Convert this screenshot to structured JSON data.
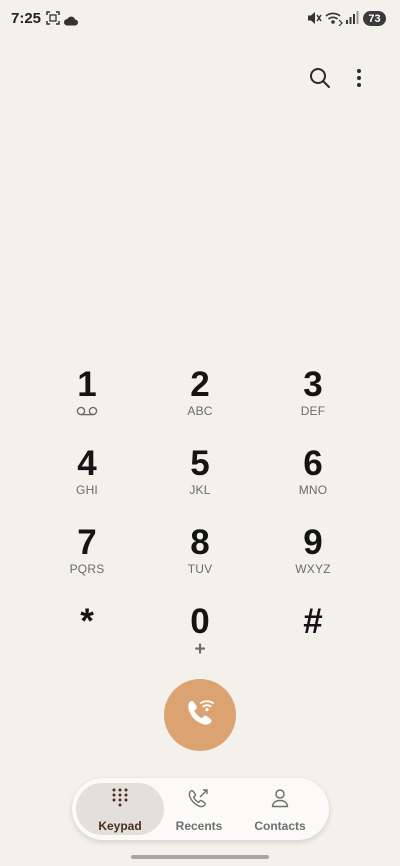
{
  "status_bar": {
    "time": "7:25",
    "battery": "73",
    "icons": [
      "screenshot-icon",
      "cloud-icon",
      "mute-icon",
      "wifi-calling-icon",
      "signal-icon"
    ]
  },
  "top_actions": [
    "search-icon",
    "more-options-icon"
  ],
  "keypad": [
    {
      "digit": "1",
      "sub": "",
      "sub_icon": "voicemail-icon"
    },
    {
      "digit": "2",
      "sub": "ABC"
    },
    {
      "digit": "3",
      "sub": "DEF"
    },
    {
      "digit": "4",
      "sub": "GHI"
    },
    {
      "digit": "5",
      "sub": "JKL"
    },
    {
      "digit": "6",
      "sub": "MNO"
    },
    {
      "digit": "7",
      "sub": "PQRS"
    },
    {
      "digit": "8",
      "sub": "TUV"
    },
    {
      "digit": "9",
      "sub": "WXYZ"
    },
    {
      "digit": "*",
      "sub": ""
    },
    {
      "digit": "0",
      "sub": "+"
    },
    {
      "digit": "#",
      "sub": ""
    }
  ],
  "call_button": {
    "icon": "wifi-call-icon",
    "color": "#dba272"
  },
  "bottom_nav": {
    "tabs": [
      {
        "label": "Keypad",
        "icon": "keypad-icon",
        "active": true
      },
      {
        "label": "Recents",
        "icon": "recents-icon",
        "active": false
      },
      {
        "label": "Contacts",
        "icon": "contacts-icon",
        "active": false
      }
    ]
  },
  "colors": {
    "background": "#f4f0ec",
    "accent": "#dba272",
    "active_pill": "#e3dfda"
  }
}
